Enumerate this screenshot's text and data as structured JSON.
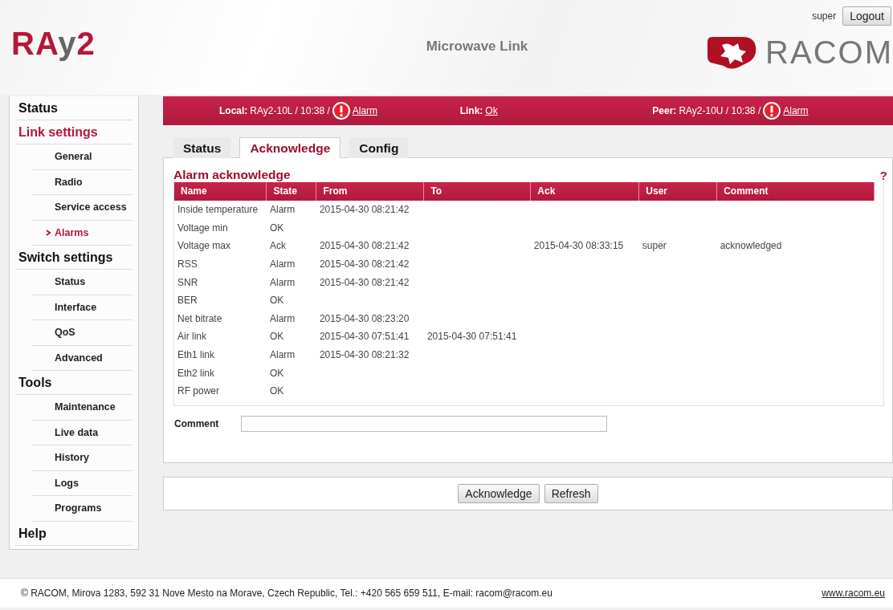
{
  "header": {
    "product_logo": {
      "main": "RA",
      "accent": "y",
      "number": "2"
    },
    "title": "Microwave Link",
    "user": "super",
    "logout": "Logout",
    "company_logo": "RACOM"
  },
  "sidebar": {
    "items": [
      {
        "label": "Status",
        "selected": false
      },
      {
        "label": "Link settings",
        "selected": true,
        "children": [
          {
            "label": "General",
            "selected": false
          },
          {
            "label": "Radio",
            "selected": false
          },
          {
            "label": "Service access",
            "selected": false
          },
          {
            "label": "Alarms",
            "selected": true
          }
        ]
      },
      {
        "label": "Switch settings",
        "selected": false,
        "children": [
          {
            "label": "Status",
            "selected": false
          },
          {
            "label": "Interface",
            "selected": false
          },
          {
            "label": "QoS",
            "selected": false
          },
          {
            "label": "Advanced",
            "selected": false
          }
        ]
      },
      {
        "label": "Tools",
        "selected": false,
        "children": [
          {
            "label": "Maintenance",
            "selected": false
          },
          {
            "label": "Live data",
            "selected": false
          },
          {
            "label": "History",
            "selected": false
          },
          {
            "label": "Logs",
            "selected": false
          },
          {
            "label": "Programs",
            "selected": false
          }
        ]
      },
      {
        "label": "Help",
        "selected": false
      }
    ]
  },
  "status_bar": {
    "local": {
      "label": "Local:",
      "value": "RAy2-10L / 10:38 /",
      "alarm": true,
      "link": "Alarm"
    },
    "link": {
      "label": "Link:",
      "link": "Ok"
    },
    "peer": {
      "label": "Peer:",
      "value": "RAy2-10U / 10:38 /",
      "alarm": true,
      "link": "Alarm"
    }
  },
  "tabs": [
    {
      "label": "Status",
      "selected": false
    },
    {
      "label": "Acknowledge",
      "selected": true
    },
    {
      "label": "Config",
      "selected": false
    }
  ],
  "panel": {
    "title": "Alarm acknowledge",
    "help": "?"
  },
  "table": {
    "columns": [
      "Name",
      "State",
      "From",
      "To",
      "Ack",
      "User",
      "Comment"
    ],
    "rows": [
      [
        "Inside temperature",
        "Alarm",
        "2015-04-30 08:21:42",
        "",
        "",
        "",
        ""
      ],
      [
        "Voltage min",
        "OK",
        "",
        "",
        "",
        "",
        ""
      ],
      [
        "Voltage max",
        "Ack",
        "2015-04-30 08:21:42",
        "",
        "2015-04-30 08:33:15",
        "super",
        "acknowledged"
      ],
      [
        "RSS",
        "Alarm",
        "2015-04-30 08:21:42",
        "",
        "",
        "",
        ""
      ],
      [
        "SNR",
        "Alarm",
        "2015-04-30 08:21:42",
        "",
        "",
        "",
        ""
      ],
      [
        "BER",
        "OK",
        "",
        "",
        "",
        "",
        ""
      ],
      [
        "Net bitrate",
        "Alarm",
        "2015-04-30 08:23:20",
        "",
        "",
        "",
        ""
      ],
      [
        "Air link",
        "OK",
        "2015-04-30 07:51:41",
        "2015-04-30 07:51:41",
        "",
        "",
        ""
      ],
      [
        "Eth1 link",
        "Alarm",
        "2015-04-30 08:21:32",
        "",
        "",
        "",
        ""
      ],
      [
        "Eth2 link",
        "OK",
        "",
        "",
        "",
        "",
        ""
      ],
      [
        "RF power",
        "OK",
        "",
        "",
        "",
        "",
        ""
      ]
    ]
  },
  "comment": {
    "label": "Comment"
  },
  "buttons": [
    "Acknowledge",
    "Refresh"
  ],
  "footer": {
    "address": "© RACOM, Mirova 1283, 592 31 Nove Mesto na Morave, Czech Republic, Tel.: +420 565 659 511, E-mail: racom@racom.eu",
    "website": "www.racom.eu"
  }
}
